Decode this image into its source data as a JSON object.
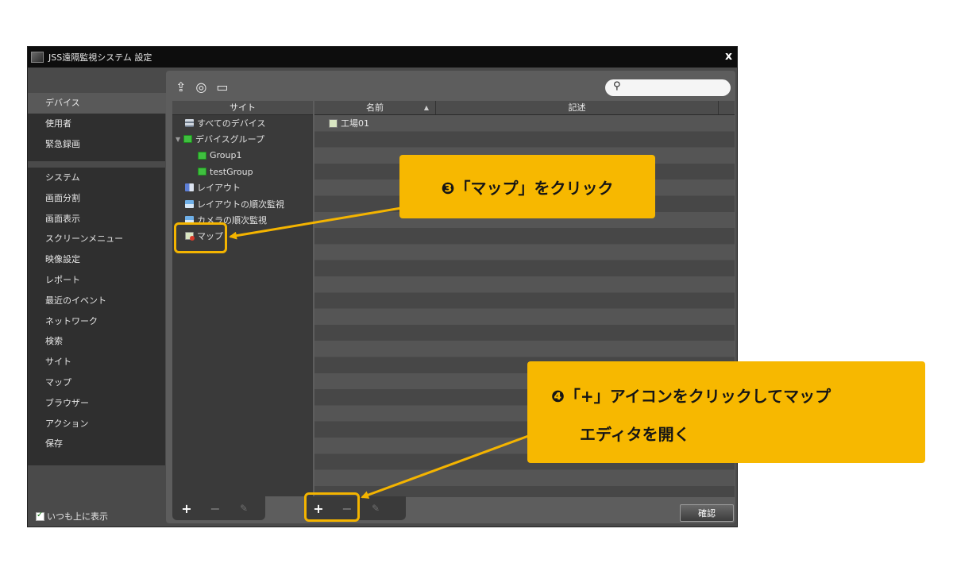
{
  "window": {
    "title": "JSS遠隔監視システム 設定",
    "close": "x"
  },
  "nav": {
    "group1": [
      "デバイス",
      "使用者",
      "緊急録画"
    ],
    "group2": [
      "システム",
      "画面分割",
      "画面表示",
      "スクリーンメニュー",
      "映像設定",
      "レポート",
      "最近のイベント",
      "ネットワーク",
      "検索",
      "サイト",
      "マップ",
      "ブラウザー",
      "アクション",
      "保存"
    ],
    "always_on_top": "いつも上に表示"
  },
  "site_panel": {
    "header": "サイト",
    "tree": [
      {
        "label": "すべてのデバイス",
        "icon": "device-list-icon"
      },
      {
        "label": "デバイスグループ",
        "icon": "group-icon"
      },
      {
        "label": "Group1",
        "icon": "group-icon"
      },
      {
        "label": "testGroup",
        "icon": "group-icon"
      },
      {
        "label": "レイアウト",
        "icon": "layout-icon"
      },
      {
        "label": "レイアウトの順次監視",
        "icon": "sequence-icon"
      },
      {
        "label": "カメラの順次監視",
        "icon": "sequence-icon"
      },
      {
        "label": "マップ",
        "icon": "map-icon"
      }
    ]
  },
  "list": {
    "col_name": "名前",
    "col_desc": "記述",
    "rows": [
      {
        "name": "工場01"
      }
    ]
  },
  "buttons": {
    "add": "+",
    "remove": "−",
    "edit": "✎",
    "confirm": "確認"
  },
  "callouts": {
    "c1": "❸「マップ」をクリック",
    "c2_line1": "❹「+」アイコンをクリックしてマップ",
    "c2_line2": "エディタを開く"
  },
  "colors": {
    "accent": "#f7b800",
    "window_bg": "#4a4a4a",
    "titlebar": "#0d0d0d"
  }
}
